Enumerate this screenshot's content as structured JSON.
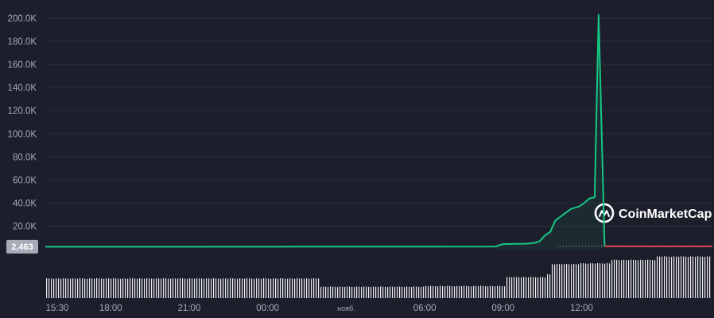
{
  "chart_data": {
    "type": "line",
    "title": "",
    "xlabel": "",
    "ylabel": "",
    "ylim": [
      0,
      210000
    ],
    "grid": "horizontal",
    "y_ticks": [
      "20.0K",
      "40.0K",
      "60.0K",
      "80.0K",
      "100.0K",
      "120.0K",
      "140.0K",
      "160.0K",
      "180.0K",
      "200.0K"
    ],
    "y_tick_values": [
      20000,
      40000,
      60000,
      80000,
      100000,
      120000,
      140000,
      160000,
      180000,
      200000
    ],
    "x_ticks": [
      {
        "label": "15:30",
        "h": 0
      },
      {
        "label": "18:00",
        "h": 2.5
      },
      {
        "label": "21:00",
        "h": 5.5
      },
      {
        "label": "00:00",
        "h": 8.5
      },
      {
        "label": "нояб.",
        "h": 11.5
      },
      {
        "label": "06:00",
        "h": 14.5
      },
      {
        "label": "09:00",
        "h": 17.5
      },
      {
        "label": "12:00",
        "h": 20.5
      }
    ],
    "x_range_hours": [
      0,
      25.5
    ],
    "current_price": {
      "label": "2,463",
      "value": 2463
    },
    "series": [
      {
        "color_up": "#16c784",
        "color_down": "#ea3943",
        "points": [
          [
            0,
            2100
          ],
          [
            5,
            2150
          ],
          [
            10,
            2200
          ],
          [
            15,
            2300
          ],
          [
            17.2,
            2350
          ],
          [
            17.5,
            4500
          ],
          [
            18.4,
            4800
          ],
          [
            18.7,
            5500
          ],
          [
            18.9,
            7000
          ],
          [
            19.1,
            12000
          ],
          [
            19.3,
            15000
          ],
          [
            19.5,
            25000
          ],
          [
            19.8,
            30000
          ],
          [
            20.1,
            35000
          ],
          [
            20.4,
            37000
          ],
          [
            20.6,
            40000
          ],
          [
            20.8,
            44000
          ],
          [
            21.0,
            45000
          ],
          [
            21.15,
            203000
          ],
          [
            21.38,
            2600
          ],
          [
            23.0,
            2500
          ],
          [
            25.5,
            2463
          ]
        ],
        "red_from": [
          21.38,
          2463
        ]
      }
    ],
    "volume": {
      "start_h": 0,
      "end_h": 25.5,
      "segments": [
        {
          "from_h": 0,
          "to_h": 10.5,
          "level": 0.58
        },
        {
          "from_h": 10.5,
          "to_h": 14.5,
          "level": 0.34
        },
        {
          "from_h": 14.5,
          "to_h": 17.6,
          "level": 0.36
        },
        {
          "from_h": 17.6,
          "to_h": 19.1,
          "level": 0.62
        },
        {
          "from_h": 19.1,
          "to_h": 19.3,
          "level": 0.7
        },
        {
          "from_h": 19.3,
          "to_h": 20.4,
          "level": 1.0
        },
        {
          "from_h": 20.4,
          "to_h": 21.6,
          "level": 1.02
        },
        {
          "from_h": 21.6,
          "to_h": 23.3,
          "level": 1.12
        },
        {
          "from_h": 23.3,
          "to_h": 25.5,
          "level": 1.22
        }
      ]
    }
  },
  "watermark": {
    "text": "CoinMarketCap",
    "icon": "coinmarketcap-logo-icon"
  },
  "colors": {
    "background": "#1c1e2b",
    "grid": "#2a2d3b",
    "axis_text": "#a7abb8",
    "price_tag_bg": "#a7abb8",
    "volume_bar": "#ffffff"
  }
}
